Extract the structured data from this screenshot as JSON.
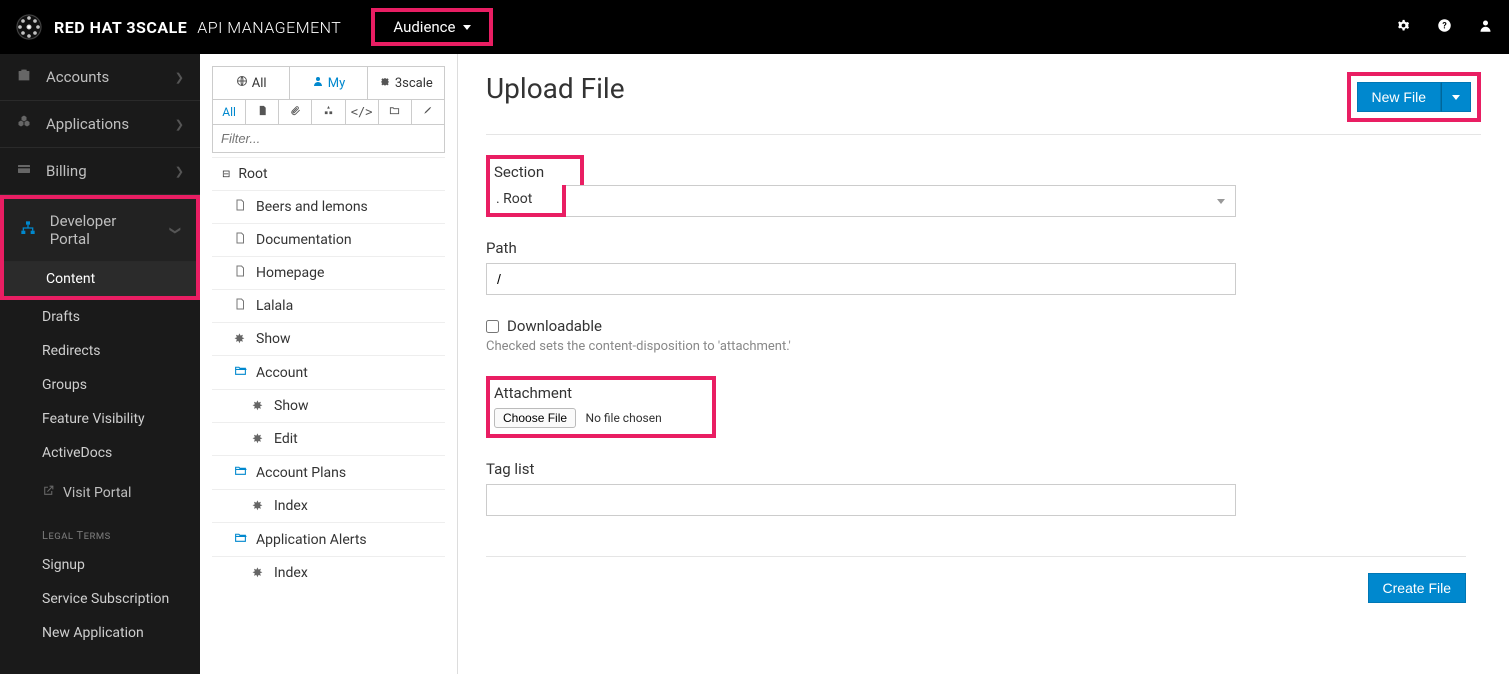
{
  "brand": {
    "redhat": "RED HAT",
    "threescale": "3SCALE",
    "sub": "API MANAGEMENT"
  },
  "top": {
    "audience": "Audience"
  },
  "sidebar": {
    "accounts": "Accounts",
    "applications": "Applications",
    "billing": "Billing",
    "dev_portal": "Developer Portal",
    "subs": {
      "content": "Content",
      "drafts": "Drafts",
      "redirects": "Redirects",
      "groups": "Groups",
      "feature_visibility": "Feature Visibility",
      "activedocs": "ActiveDocs",
      "visit_portal": "Visit Portal",
      "legal_heading": "Legal Terms",
      "signup": "Signup",
      "service_subscription": "Service Subscription",
      "new_application": "New Application"
    }
  },
  "tree": {
    "tabs": {
      "all": "All",
      "my": "My",
      "threescale": "3scale"
    },
    "filter_all": "All",
    "filter_placeholder": "Filter...",
    "nodes": {
      "root": "Root",
      "beers": "Beers and lemons",
      "documentation": "Documentation",
      "homepage": "Homepage",
      "lalala": "Lalala",
      "show": "Show",
      "account": "Account",
      "acc_show": "Show",
      "acc_edit": "Edit",
      "account_plans": "Account Plans",
      "ap_index": "Index",
      "application_alerts": "Application Alerts",
      "aa_index": "Index"
    }
  },
  "main": {
    "title": "Upload File",
    "new_file_btn": "New File",
    "section_label": "Section",
    "section_value": ". Root",
    "path_label": "Path",
    "path_value": "/",
    "downloadable_label": "Downloadable",
    "downloadable_help": "Checked sets the content-disposition to 'attachment.'",
    "attachment_label": "Attachment",
    "choose_file": "Choose File",
    "no_file": "No file chosen",
    "tag_list_label": "Tag list",
    "create_btn": "Create File"
  }
}
